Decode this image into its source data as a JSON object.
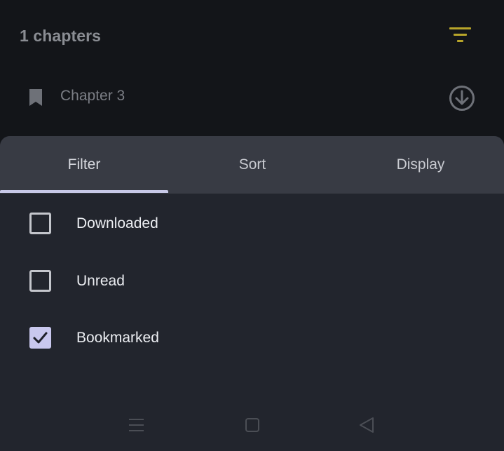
{
  "header": {
    "chapters_count": "1 chapters",
    "filter_icon": "filter-icon"
  },
  "chapters": [
    {
      "title": "Chapter 3",
      "bookmarked": true,
      "icon": "download-icon"
    }
  ],
  "sheet": {
    "tabs": [
      {
        "label": "Filter",
        "active": true
      },
      {
        "label": "Sort",
        "active": false
      },
      {
        "label": "Display",
        "active": false
      }
    ],
    "options": [
      {
        "label": "Downloaded",
        "checked": false
      },
      {
        "label": "Unread",
        "checked": false
      },
      {
        "label": "Bookmarked",
        "checked": true
      }
    ]
  },
  "navbar": {
    "items": [
      "menu-icon",
      "home-icon",
      "back-icon"
    ]
  },
  "colors": {
    "accent": "#c9c8ee",
    "filter_icon": "#b8a52a",
    "sheet_bg": "#22252d",
    "tabs_bg": "#383b44"
  }
}
